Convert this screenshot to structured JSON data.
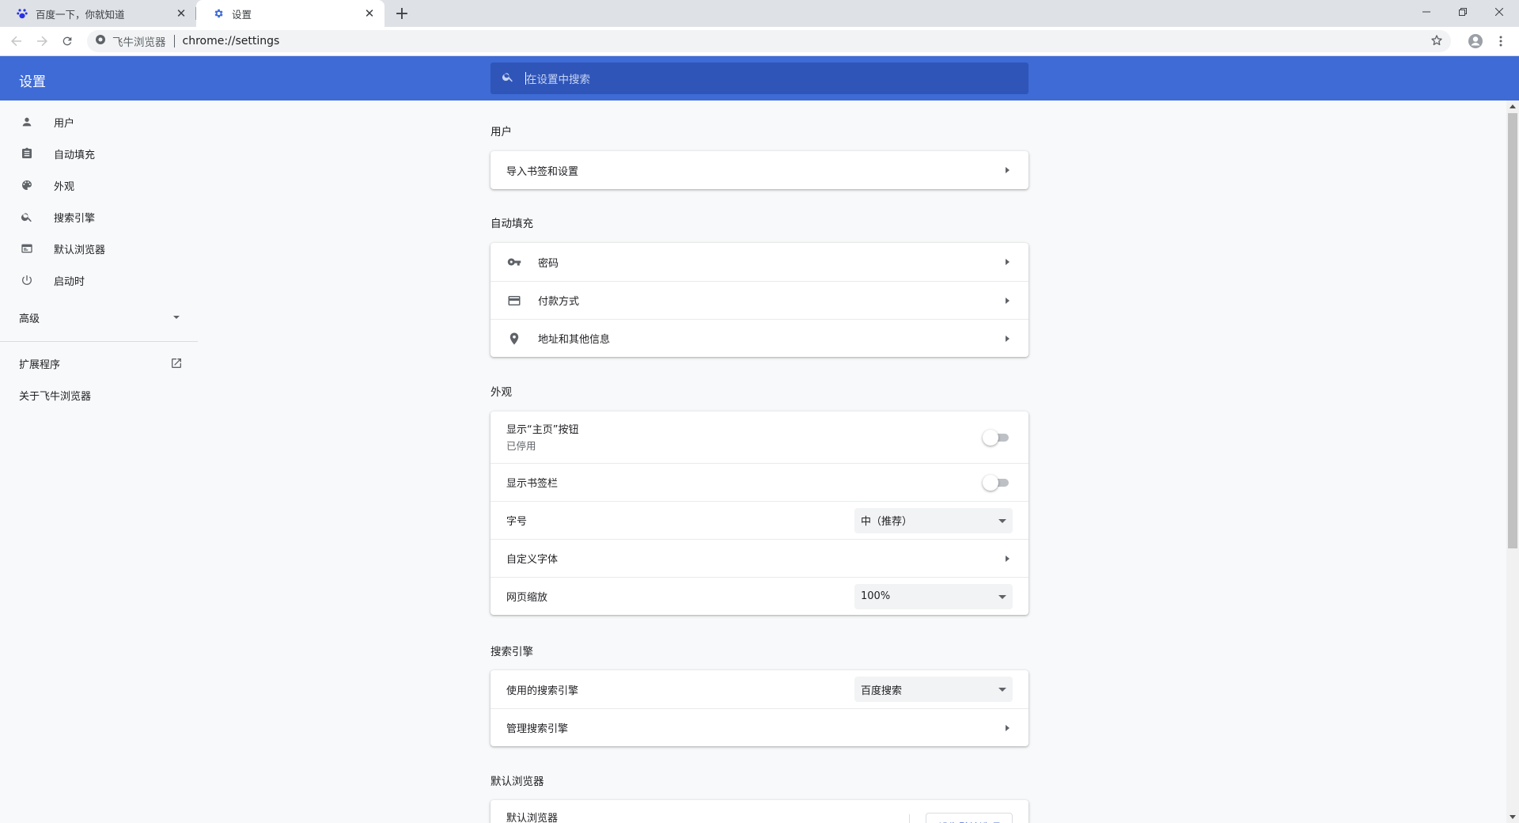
{
  "tabs": [
    {
      "title": "百度一下，你就知道",
      "icon": "baidu-paw-icon"
    },
    {
      "title": "设置",
      "icon": "gear-icon"
    }
  ],
  "toolbar": {
    "site_name": "飞牛浏览器",
    "url": "chrome://settings"
  },
  "header": {
    "title": "设置",
    "search_placeholder": "在设置中搜索"
  },
  "sidebar": {
    "items": [
      {
        "label": "用户",
        "icon": "person-icon"
      },
      {
        "label": "自动填充",
        "icon": "clipboard-icon"
      },
      {
        "label": "外观",
        "icon": "palette-icon"
      },
      {
        "label": "搜索引擎",
        "icon": "search-icon"
      },
      {
        "label": "默认浏览器",
        "icon": "browser-window-icon"
      },
      {
        "label": "启动时",
        "icon": "power-icon"
      }
    ],
    "advanced": "高级",
    "extensions": "扩展程序",
    "about": "关于飞牛浏览器"
  },
  "sections": {
    "user": {
      "title": "用户",
      "import": "导入书签和设置"
    },
    "autofill": {
      "title": "自动填充",
      "passwords": "密码",
      "payments": "付款方式",
      "addresses": "地址和其他信息"
    },
    "appearance": {
      "title": "外观",
      "home_button": "显示“主页”按钮",
      "home_button_sub": "已停用",
      "bookmarks_bar": "显示书签栏",
      "font_size": "字号",
      "font_size_value": "中（推荐）",
      "custom_fonts": "自定义字体",
      "zoom": "网页缩放",
      "zoom_value": "100%"
    },
    "search": {
      "title": "搜索引擎",
      "engine": "使用的搜索引擎",
      "engine_value": "百度搜索",
      "manage": "管理搜索引擎"
    },
    "default_browser": {
      "title": "默认浏览器",
      "row": "默认浏览器",
      "button": "设为默认选项"
    }
  },
  "colors": {
    "accent": "#3f6bd6",
    "search_bg": "#2f55b8"
  }
}
